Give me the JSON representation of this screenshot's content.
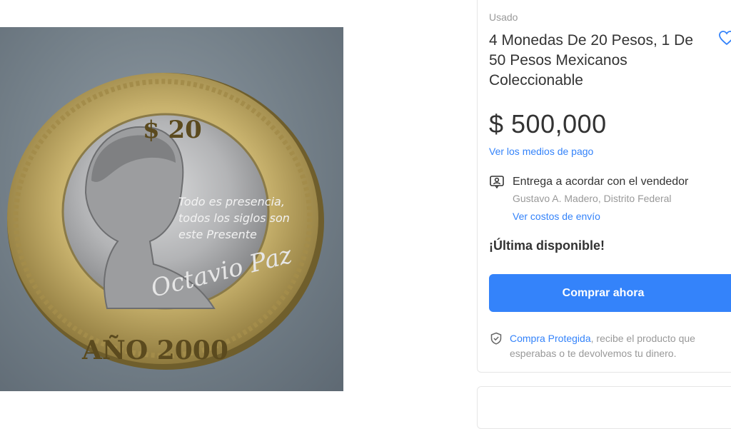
{
  "gallery": {
    "image_alt": "Moneda de 20 pesos año 2000 Octavio Paz",
    "coin": {
      "denomination": "$ 20",
      "quote_line1": "Todo es presencia,",
      "quote_line2": "todos los siglos son",
      "quote_line3": "este Presente",
      "year": "AÑO 2000",
      "signature": "Octavio Paz"
    }
  },
  "listing": {
    "condition": "Usado",
    "title": "4 Monedas De 20 Pesos, 1 De 50 Pesos Mexicanos Coleccionable",
    "price": "$ 500,000",
    "payment_link": "Ver los medios de pago",
    "delivery": {
      "icon": "person-pin-icon",
      "text": "Entrega a acordar con el vendedor",
      "location": "Gustavo A. Madero, Distrito Federal",
      "shipping_link": "Ver costos de envío"
    },
    "stock": "¡Última disponible!",
    "buy_button": "Comprar ahora",
    "protection": {
      "icon": "shield-check-icon",
      "link": "Compra Protegida",
      "text": ", recibe el producto que esperabas o te devolvemos tu dinero."
    },
    "favorite_icon": "heart-icon"
  },
  "colors": {
    "accent": "#3483fa",
    "text": "#333333",
    "muted": "#999999"
  }
}
